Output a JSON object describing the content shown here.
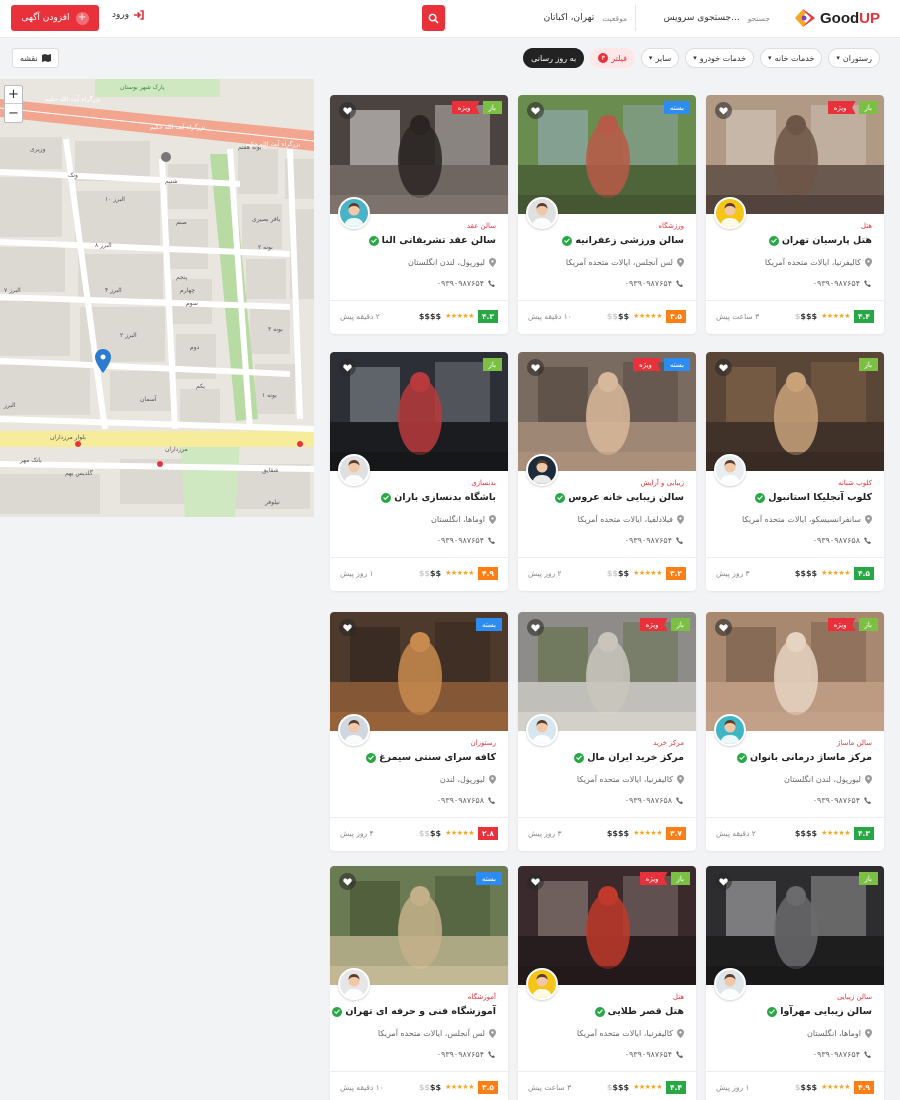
{
  "header": {
    "logo_main": "Good",
    "logo_accent": "UP",
    "search": {
      "keyword_label": "جستجو",
      "keyword_placeholder": "جستجوی سرویس...",
      "location_label": "موقعیت",
      "location_value": "تهران، اکباتان"
    },
    "login_label": "ورود",
    "add_listing_label": "افزودن آگهی"
  },
  "filters": {
    "items": [
      "رستوران",
      "خدمات خانه",
      "خدمات خودرو",
      "سایر"
    ],
    "filter_label": "فیلتر",
    "filter_count": "۳",
    "update_label": "به روز رسانی"
  },
  "map": {
    "toggle_label": "نقشه",
    "zoom_in": "+",
    "zoom_out": "−",
    "street_labels": [
      "بزرگراه آیت الله حکیم",
      "بزرگراه آیت الله حکیم",
      "بزرگراه آیت الله حکیم",
      "پارک شهر بوستان",
      "ونک",
      "وزیری",
      "البرز ۱۰",
      "البرز ۸",
      "البرز ۴",
      "البرز ۲",
      "البرز ۷",
      "البرز",
      "صنم",
      "پنجم",
      "چهارم",
      "سوم",
      "دوم",
      "یکم",
      "بافر بصیری",
      "بونه ۲",
      "بونه ۱",
      "بونه ۳",
      "بونه هفتم",
      "شنبم",
      "بلوار مرزداران",
      "مرزداران",
      "گلدیس بهم",
      "شقایق",
      "نیلوفر",
      "آسمان",
      "بانک مهر"
    ]
  },
  "listings": [
    {
      "category": "هتل",
      "title": "هتل پارسیان تهران",
      "address": "کالیفرنیا، ایالات متحده آمریکا",
      "phone": "۰۹۳۹۰۹۸۷۶۵۴",
      "score": "۴.۴",
      "score_color": "#28a745",
      "price_on": "$$$",
      "price_off": "$",
      "time": "۳ ساعت پیش",
      "badges": [
        {
          "label": "باز",
          "type": "open"
        },
        {
          "label": "ویژه",
          "type": "special"
        }
      ],
      "image": "hotel"
    },
    {
      "category": "ورزشگاه",
      "title": "سالن ورزشی زعفرانیه",
      "address": "لس آنجلس، ایالات متحده آمریکا",
      "phone": "۰۹۳۹۰۹۸۷۶۵۴",
      "score": "۳.۵",
      "score_color": "#fd7e14",
      "price_on": "$$",
      "price_off": "$$",
      "time": "۱۰ دقیقه پیش",
      "badges": [
        {
          "label": "بسته",
          "type": "closed"
        }
      ],
      "image": "sport"
    },
    {
      "category": "سالن عقد",
      "title": "سالن عقد تشریفاتی النا",
      "address": "لیورپول، لندن انگلستان",
      "phone": "۰۹۳۹۰۹۸۷۶۵۴",
      "score": "۴.۳",
      "score_color": "#28a745",
      "price_on": "$$$$",
      "price_off": "",
      "time": "۲ دقیقه پیش",
      "badges": [
        {
          "label": "باز",
          "type": "open"
        },
        {
          "label": "ویژه",
          "type": "special"
        }
      ],
      "image": "wedding"
    },
    {
      "category": "کلوب شبانه",
      "title": "کلوب آنجلیکا استانبول",
      "address": "سانفرانسیسکو، ایالات متحده آمریکا",
      "phone": "۰۹۳۹۰۹۸۷۶۵۸",
      "score": "۴.۵",
      "score_color": "#28a745",
      "price_on": "$$$$",
      "price_off": "",
      "time": "۳ روز پیش",
      "badges": [
        {
          "label": "باز",
          "type": "open"
        }
      ],
      "image": "club"
    },
    {
      "category": "زیبایی و آرایش",
      "title": "سالن زیبایی خانه عروس",
      "address": "فیلادلفیا، ایالات متحده آمریکا",
      "phone": "۰۹۳۹۰۹۸۷۶۵۴",
      "score": "۳.۲",
      "score_color": "#fd7e14",
      "price_on": "$$",
      "price_off": "$$",
      "time": "۲ روز پیش",
      "badges": [
        {
          "label": "بسته",
          "type": "closed"
        },
        {
          "label": "ویژه",
          "type": "special"
        }
      ],
      "image": "beauty"
    },
    {
      "category": "بدنسازی",
      "title": "باشگاه بدنسازی باران",
      "address": "اوماها، انگلستان",
      "phone": "۰۹۳۹۰۹۸۷۶۵۴",
      "score": "۴.۹",
      "score_color": "#fd7e14",
      "price_on": "$$",
      "price_off": "$$",
      "time": "۱ روز پیش",
      "badges": [
        {
          "label": "باز",
          "type": "open"
        }
      ],
      "image": "gym"
    },
    {
      "category": "سالن ماساژ",
      "title": "مرکز ماساژ درمانی بانوان",
      "address": "لیورپول، لندن انگلستان",
      "phone": "۰۹۳۹۰۹۸۷۶۵۴",
      "score": "۴.۳",
      "score_color": "#28a745",
      "price_on": "$$$$",
      "price_off": "",
      "time": "۲ دقیقه پیش",
      "badges": [
        {
          "label": "باز",
          "type": "open"
        },
        {
          "label": "ویژه",
          "type": "special"
        }
      ],
      "image": "massage"
    },
    {
      "category": "مرکز خرید",
      "title": "مرکز خرید ایران مال",
      "address": "کالیفرنیا، ایالات متحده آمریکا",
      "phone": "۰۹۳۹۰۹۸۷۶۵۸",
      "score": "۳.۷",
      "score_color": "#fd7e14",
      "price_on": "$$$$",
      "price_off": "",
      "time": "۳ روز پیش",
      "badges": [
        {
          "label": "باز",
          "type": "open"
        },
        {
          "label": "ویژه",
          "type": "special"
        }
      ],
      "image": "mall"
    },
    {
      "category": "رستوران",
      "title": "کافه سرای سنتی سیمرغ",
      "address": "لیورپول، لندن",
      "phone": "۰۹۳۹۰۹۸۷۶۵۸",
      "score": "۲.۸",
      "score_color": "#e8313a",
      "price_on": "$$",
      "price_off": "$$",
      "time": "۴ روز پیش",
      "badges": [
        {
          "label": "بسته",
          "type": "closed"
        }
      ],
      "image": "cafe"
    },
    {
      "category": "سالن زیبایی",
      "title": "سالن زیبایی مهرآوا",
      "address": "اوماها، انگلستان",
      "phone": "۰۹۳۹۰۹۸۷۶۵۴",
      "score": "۴.۹",
      "score_color": "#fd7e14",
      "price_on": "$$$",
      "price_off": "$",
      "time": "۱ روز پیش",
      "badges": [
        {
          "label": "باز",
          "type": "open"
        }
      ],
      "image": "makeup"
    },
    {
      "category": "هتل",
      "title": "هتل قصر طلایی",
      "address": "کالیفرنیا، ایالات متحده آمریکا",
      "phone": "۰۹۳۹۰۹۸۷۶۵۴",
      "score": "۴.۴",
      "score_color": "#28a745",
      "price_on": "$$$",
      "price_off": "$",
      "time": "۳ ساعت پیش",
      "badges": [
        {
          "label": "باز",
          "type": "open"
        },
        {
          "label": "ویژه",
          "type": "special"
        }
      ],
      "image": "hall"
    },
    {
      "category": "آموزشگاه",
      "title": "آموزشگاه فنی و حرفه ای تهران",
      "address": "لس آنجلس، ایالات متحده آمریکا",
      "phone": "۰۹۳۹۰۹۸۷۶۵۴",
      "score": "۳.۵",
      "score_color": "#fd7e14",
      "price_on": "$$",
      "price_off": "$$",
      "time": "۱۰ دقیقه پیش",
      "badges": [
        {
          "label": "بسته",
          "type": "closed"
        }
      ],
      "image": "shop"
    }
  ]
}
